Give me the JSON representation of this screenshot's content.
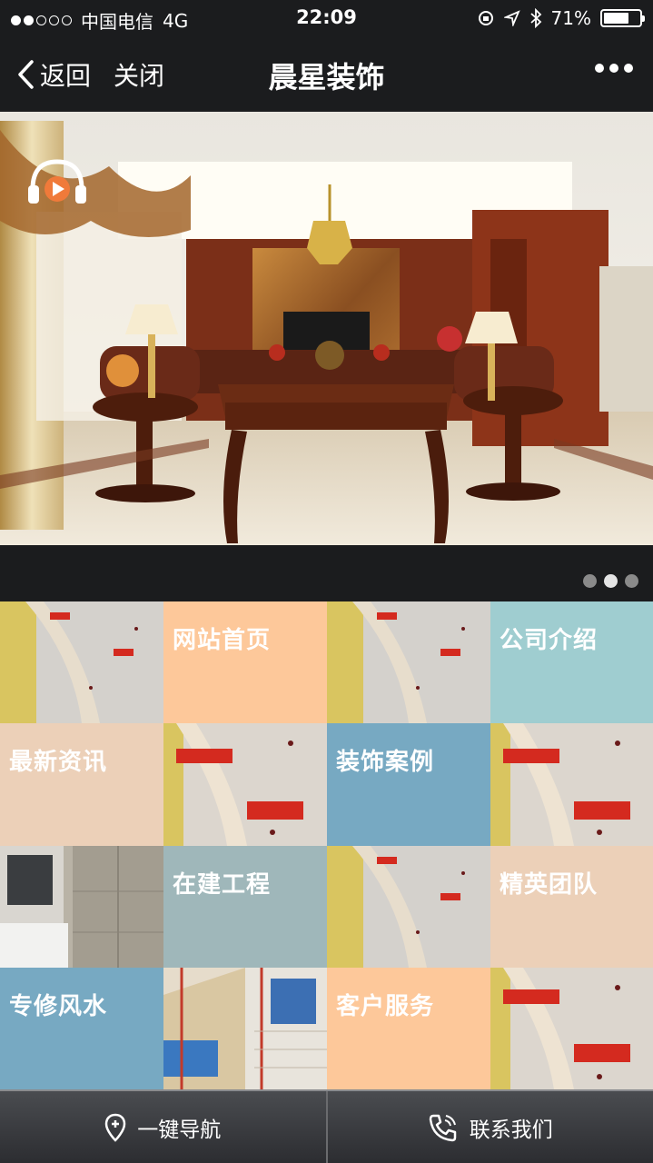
{
  "status_bar": {
    "carrier": "中国电信",
    "network": "4G",
    "time": "22:09",
    "battery": "71%",
    "battery_level": 0.71
  },
  "nav": {
    "back_label": "返回",
    "close_label": "关闭",
    "title": "晨星装饰"
  },
  "banner": {
    "slide_count": 3,
    "active_slide": 2
  },
  "grid": {
    "tiles": [
      {
        "label": "网站首页",
        "color": "#fdc89a"
      },
      {
        "label": "公司介绍",
        "color": "#9fcdd0"
      },
      {
        "label": "最新资讯",
        "color": "#ecd0b8"
      },
      {
        "label": "装饰案例",
        "color": "#77a9c2"
      },
      {
        "label": "在建工程",
        "color": "#9fb7ba"
      },
      {
        "label": "精英团队",
        "color": "#ecd0b8"
      },
      {
        "label": "专修风水",
        "color": "#77a9c2"
      },
      {
        "label": "客户服务",
        "color": "#fdc89a"
      }
    ]
  },
  "bottom_bar": {
    "navigate_label": "一键导航",
    "contact_label": "联系我们"
  },
  "icons": {
    "back": "chevron-left-icon",
    "more": "more-dots-icon",
    "audio": "headphones-icon",
    "location": "location-pin-icon",
    "phone": "phone-icon"
  }
}
